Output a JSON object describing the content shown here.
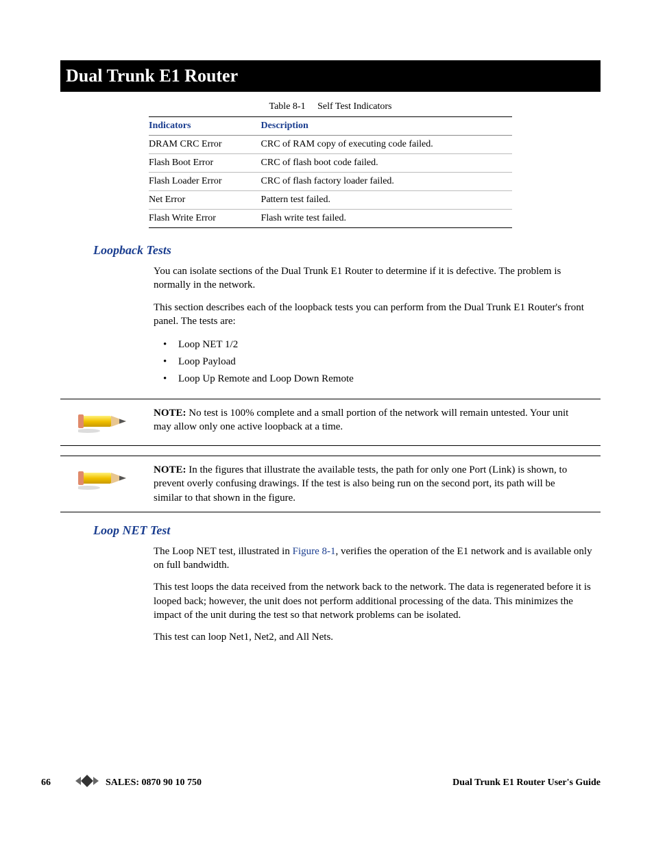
{
  "header": {
    "title": "Dual Trunk E1 Router"
  },
  "table": {
    "caption_num": "Table 8-1",
    "caption_title": "Self Test Indicators",
    "col1": "Indicators",
    "col2": "Description",
    "rows": [
      {
        "ind": "DRAM CRC Error",
        "desc": "CRC of RAM copy of executing code failed."
      },
      {
        "ind": "Flash Boot Error",
        "desc": "CRC of flash boot code failed."
      },
      {
        "ind": "Flash Loader Error",
        "desc": "CRC of flash factory loader failed."
      },
      {
        "ind": "Net Error",
        "desc": "Pattern test failed."
      },
      {
        "ind": "Flash Write Error",
        "desc": "Flash write test failed."
      }
    ]
  },
  "sec1": {
    "heading": "Loopback Tests",
    "p1": "You can isolate sections of the Dual Trunk E1 Router to determine if it is defective. The problem is normally in the network.",
    "p2": "This section describes each of the loopback tests you can perform from the Dual Trunk E1 Router's front panel. The tests are:",
    "bullets": [
      "Loop NET 1/2",
      "Loop Payload",
      "Loop Up Remote and Loop Down Remote"
    ]
  },
  "note1": {
    "label": "NOTE:",
    "text": " No test is 100% complete and a small portion of the network will remain untested. Your unit may allow only one active loopback at a time."
  },
  "note2": {
    "label": "NOTE:",
    "text": " In the figures that illustrate the available tests, the path for only one Port (Link) is shown, to prevent overly confusing drawings. If the test is also being run on the second port, its path will be similar to that shown in the figure."
  },
  "sec2": {
    "heading": "Loop NET Test",
    "p1a": "The Loop NET test, illustrated in ",
    "p1_link": "Figure 8-1",
    "p1b": ", verifies the operation of the E1 network and is available only on full bandwidth.",
    "p2": "This test loops the data received from the network back to the network. The data is regenerated before it is looped back; however, the unit does not perform additional processing of the data. This minimizes the impact of the unit during the test so that network problems can be isolated.",
    "p3": "This test can loop Net1, Net2, and All Nets."
  },
  "footer": {
    "page": "66",
    "sales": "SALES:  0870 90 10 750",
    "guide": "Dual Trunk E1 Router User's Guide"
  }
}
